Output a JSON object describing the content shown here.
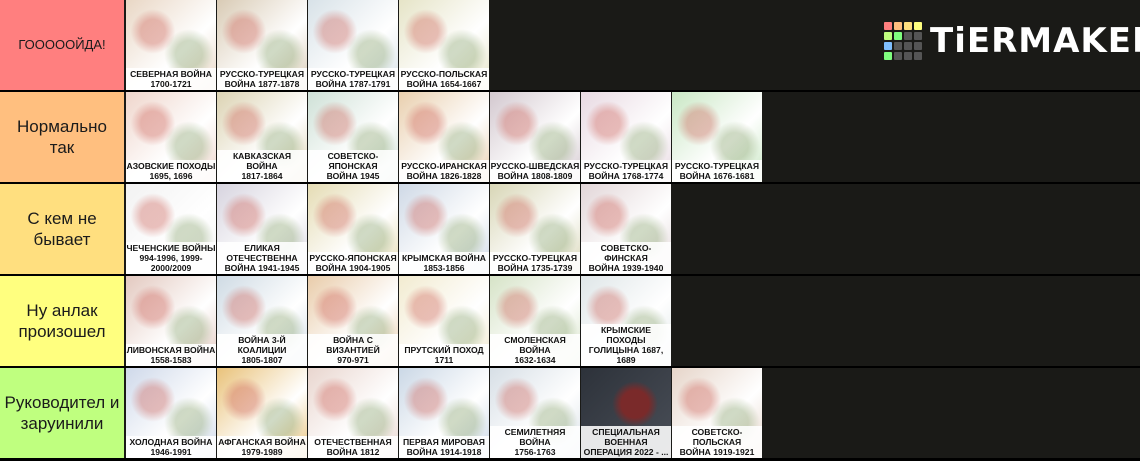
{
  "logo": {
    "text": "TiERMAKER",
    "grid_colors": [
      "#ff7f7f",
      "#ffbf7f",
      "#ffdf7f",
      "#ffff7f",
      "#bfff7f",
      "#7fff7f",
      "#555",
      "#555",
      "#7fbfff",
      "#555",
      "#555",
      "#555",
      "#7fff7f",
      "#555",
      "#555",
      "#555"
    ]
  },
  "tiers": [
    {
      "label": "ГОООООЙДА!",
      "color": "#ff7f7f",
      "items": [
        {
          "caption": "СЕВЕРНАЯ ВОЙНА\n1700-1721",
          "tint": "#e9d7c5"
        },
        {
          "caption": "РУССКО-ТУРЕЦКАЯ\nВОЙНА 1877-1878",
          "tint": "#d9cbb5"
        },
        {
          "caption": "РУССКО-ТУРЕЦКАЯ\nВОЙНА 1787-1791",
          "tint": "#d8e2e8"
        },
        {
          "caption": "РУССКО-ПОЛЬСКАЯ\nВОЙНА 1654-1667",
          "tint": "#e6e4c7"
        }
      ]
    },
    {
      "label": "Нормально так",
      "color": "#ffbf7f",
      "items": [
        {
          "caption": "АЗОВСКИЕ ПОХОДЫ\n1695, 1696",
          "tint": "#efd6cc"
        },
        {
          "caption": "КАВКАЗСКАЯ ВОЙНА\n1817-1864",
          "tint": "#dcd3b3"
        },
        {
          "caption": "СОВЕТСКО-ЯПОНСКАЯ\nВОЙНА 1945",
          "tint": "#cfe1d7"
        },
        {
          "caption": "РУССКО-ИРАНСКАЯ\nВОЙНА 1826-1828",
          "tint": "#e9cfae"
        },
        {
          "caption": "РУССКО-ШВЕДСКАЯ\nВОЙНА 1808-1809",
          "tint": "#d3c8cf"
        },
        {
          "caption": "РУССКО-ТУРЕЦКАЯ\nВОЙНА 1768-1774",
          "tint": "#e8d9e2"
        },
        {
          "caption": "РУССКО-ТУРЕЦКАЯ\nВОЙНА 1676-1681",
          "tint": "#c9e7c4"
        }
      ]
    },
    {
      "label": "С кем не бывает",
      "color": "#ffdf7f",
      "items": [
        {
          "caption": "ЧЕЧЕНСКИЕ ВОЙНЫ\n994-1996, 1999-2000/2009",
          "tint": "#f2f2f2"
        },
        {
          "caption": "ЕЛИКАЯ ОТЕЧЕСТВЕННА\nВОЙНА 1941-1945",
          "tint": "#d7d4df"
        },
        {
          "caption": "РУССКО-ЯПОНСКАЯ\nВОЙНА 1904-1905",
          "tint": "#e5dcb4"
        },
        {
          "caption": "КРЫМСКАЯ ВОЙНА\n1853-1856",
          "tint": "#cfd9e6"
        },
        {
          "caption": "РУССКО-ТУРЕЦКАЯ\nВОЙНА 1735-1739",
          "tint": "#d8d6b6"
        },
        {
          "caption": "СОВЕТСКО-ФИНСКАЯ\nВОЙНА 1939-1940",
          "tint": "#e2d6d8"
        }
      ]
    },
    {
      "label": "Ну анлак произошел",
      "color": "#ffff7f",
      "items": [
        {
          "caption": "ЛИВОНСКАЯ ВОЙНА\n1558-1583",
          "tint": "#e3c9c0"
        },
        {
          "caption": "ВОЙНА 3-Й КОАЛИЦИИ\n1805-1807",
          "tint": "#cfdbe4"
        },
        {
          "caption": "ВОЙНА С ВИЗАНТИЕЙ\n970-971",
          "tint": "#e9ccaa"
        },
        {
          "caption": "ПРУТСКИЙ ПОХОД\n1711",
          "tint": "#f2ebd0"
        },
        {
          "caption": "СМОЛЕНСКАЯ ВОЙНА\n1632-1634",
          "tint": "#d6e3c7"
        },
        {
          "caption": "КРЫМСКИЕ ПОХОДЫ\nГОЛИЦЫНА 1687, 1689",
          "tint": "#dfe6e8"
        }
      ]
    },
    {
      "label": "Руководител и заруинили",
      "color": "#bfff7f",
      "items": [
        {
          "caption": "ХОЛОДНАЯ ВОЙНА\n1946-1991",
          "tint": "#cfd9ea"
        },
        {
          "caption": "АФГАНСКАЯ ВОЙНА\n1979-1989",
          "tint": "#e9c27a"
        },
        {
          "caption": "ОТЕЧЕСТВЕННАЯ\nВОЙНА 1812",
          "tint": "#e9d6cf"
        },
        {
          "caption": "ПЕРВАЯ МИРОВАЯ\nВОЙНА 1914-1918",
          "tint": "#cbd8e6"
        },
        {
          "caption": "СЕМИЛЕТНЯЯ ВОЙНА\n1756-1763",
          "tint": "#d7dfe6"
        },
        {
          "caption": "СПЕЦИАЛЬНАЯ ВОЕННАЯ\nОПЕРАЦИЯ 2022 - ...",
          "tint": "#3a3f48"
        },
        {
          "caption": "СОВЕТСКО-ПОЛЬСКАЯ\nВОЙНА 1919-1921",
          "tint": "#e6d5c9"
        }
      ]
    }
  ]
}
